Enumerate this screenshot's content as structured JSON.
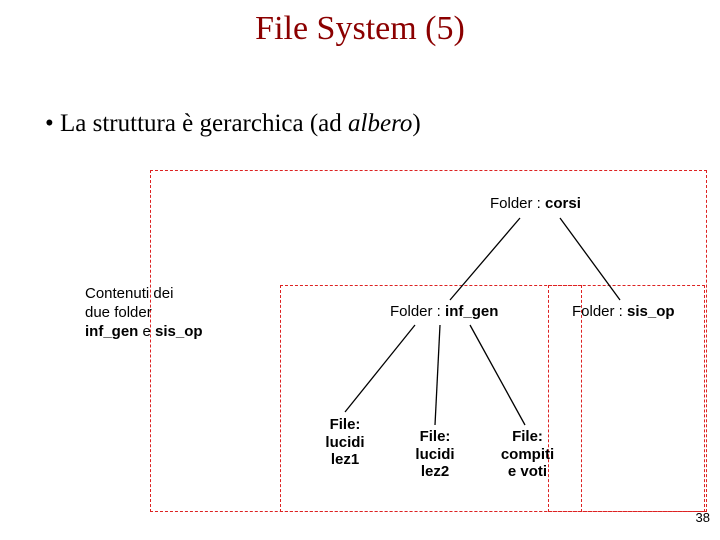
{
  "slide": {
    "title": "File System (5)",
    "bullet_prefix": "•  La struttura è gerarchica (ad ",
    "bullet_italic": "albero",
    "bullet_suffix": ")",
    "page_number": "38"
  },
  "caption": {
    "line1": "Contenuti dei",
    "line2": "due folder",
    "line3_a": "inf_gen",
    "line3_mid": " e ",
    "line3_b": "sis_op"
  },
  "labels": {
    "folder_prefix": "Folder : ",
    "corsi": "corsi",
    "inf_gen": "inf_gen",
    "sis_op": "sis_op"
  },
  "files": {
    "f1_l1": "File:",
    "f1_l2": "lucidi",
    "f1_l3": "lez1",
    "f2_l1": "File:",
    "f2_l2": "lucidi",
    "f2_l3": "lez2",
    "f3_l1": "File:",
    "f3_l2": "compiti",
    "f3_l3": "e voti"
  }
}
